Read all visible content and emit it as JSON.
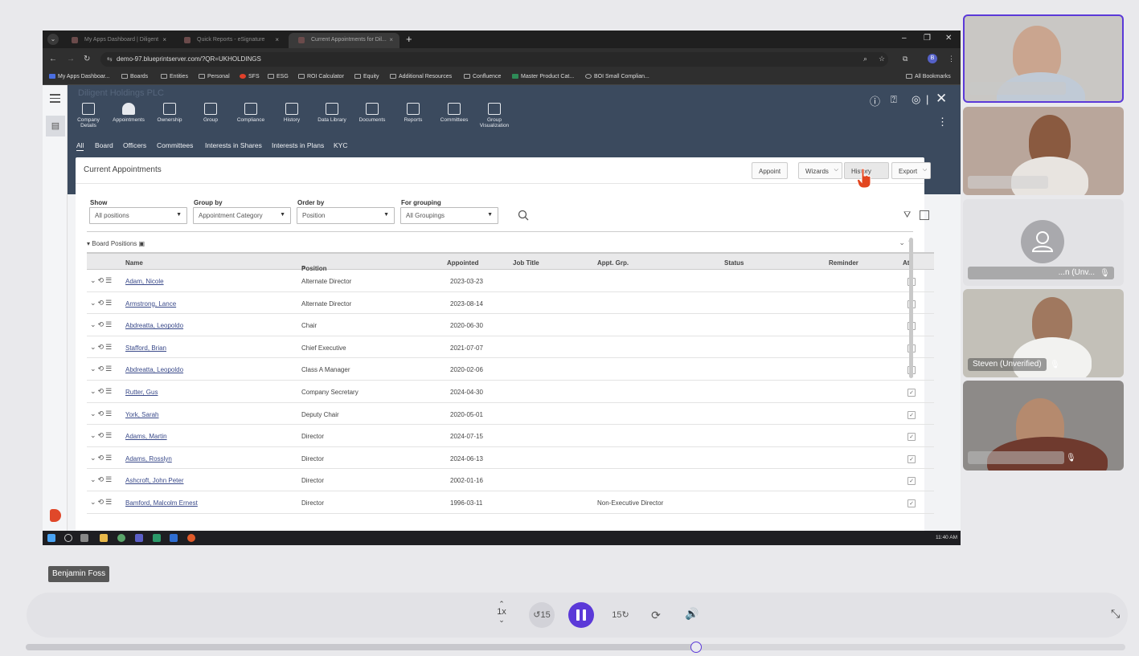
{
  "browser": {
    "tabs": [
      "My Apps Dashboard | Diligent",
      "Quick Reports - eSignature",
      "Current Appointments for Dil..."
    ],
    "new_tab": "+",
    "url": "demo-97.blueprintserver.com/?QR=UKHOLDINGS",
    "bookmarks": [
      "My Apps Dashboar...",
      "Boards",
      "Entities",
      "Personal",
      "SFS",
      "ESG",
      "ROI Calculator",
      "Equity",
      "Additional Resources",
      "Confluence",
      "Master Product Cat...",
      "BOI Small Complian..."
    ],
    "all_bookmarks": "All Bookmarks",
    "profile_initial": "B"
  },
  "app": {
    "brand": "Diligent Holdings PLC",
    "nav": [
      "Company Details",
      "Appointments",
      "Ownership",
      "Group",
      "Compliance",
      "History",
      "Data Library",
      "Documents",
      "Reports",
      "Committees",
      "Group Visualization"
    ],
    "subnav": [
      "All",
      "Board",
      "Officers",
      "Committees",
      "Interests in Shares",
      "Interests in Plans",
      "KYC"
    ],
    "panel_title": "Current Appointments",
    "toolbar": {
      "appoint": "Appoint",
      "wizards": "Wizards",
      "history": "History",
      "export": "Export"
    },
    "filters": {
      "show_label": "Show",
      "show_value": "All positions",
      "group_label": "Group by",
      "group_value": "Appointment Category",
      "order_label": "Order by",
      "order_value": "Position",
      "grouping_label": "For grouping",
      "grouping_value": "All Groupings"
    },
    "group_title": "Board Positions",
    "columns": [
      "Name",
      "Position",
      "Appointed",
      "Job Title",
      "Appt. Grp.",
      "Status",
      "Reminder",
      "Att."
    ],
    "rows": [
      {
        "name": "Adam, Nicole",
        "position": "Alternate Director",
        "appointed": "2023-03-23",
        "appt_grp": ""
      },
      {
        "name": "Armstrong, Lance",
        "position": "Alternate Director",
        "appointed": "2023-08-14",
        "appt_grp": ""
      },
      {
        "name": "Abdreatta, Leopoldo",
        "position": "Chair",
        "appointed": "2020-06-30",
        "appt_grp": ""
      },
      {
        "name": "Stafford, Brian",
        "position": "Chief Executive",
        "appointed": "2021-07-07",
        "appt_grp": ""
      },
      {
        "name": "Abdreatta, Leopoldo",
        "position": "Class A Manager",
        "appointed": "2020-02-06",
        "appt_grp": ""
      },
      {
        "name": "Rutter, Gus",
        "position": "Company Secretary",
        "appointed": "2024-04-30",
        "appt_grp": ""
      },
      {
        "name": "York, Sarah",
        "position": "Deputy Chair",
        "appointed": "2020-05-01",
        "appt_grp": ""
      },
      {
        "name": "Adams, Martin",
        "position": "Director",
        "appointed": "2024-07-15",
        "appt_grp": ""
      },
      {
        "name": "Adams, Rosslyn",
        "position": "Director",
        "appointed": "2024-06-13",
        "appt_grp": ""
      },
      {
        "name": "Ashcroft, John Peter",
        "position": "Director",
        "appointed": "2002-01-16",
        "appt_grp": ""
      },
      {
        "name": "Bamford, Malcolm Ernest",
        "position": "Director",
        "appointed": "1996-03-11",
        "appt_grp": "Non-Executive Director"
      }
    ],
    "clock": "11:40 AM"
  },
  "participants": [
    {
      "name": ""
    },
    {
      "name": ""
    },
    {
      "name": "...n (Unv..."
    },
    {
      "name": "Steven (Unverified)"
    },
    {
      "name": ""
    }
  ],
  "speaker": "Benjamin Foss",
  "player": {
    "speed": "1x",
    "skip_back": "15",
    "skip_forward": "15",
    "progress": 0.61
  },
  "colors": {
    "accent": "#5b39d8",
    "app_header": "#3b4a5e",
    "link": "#3a4a8a"
  }
}
